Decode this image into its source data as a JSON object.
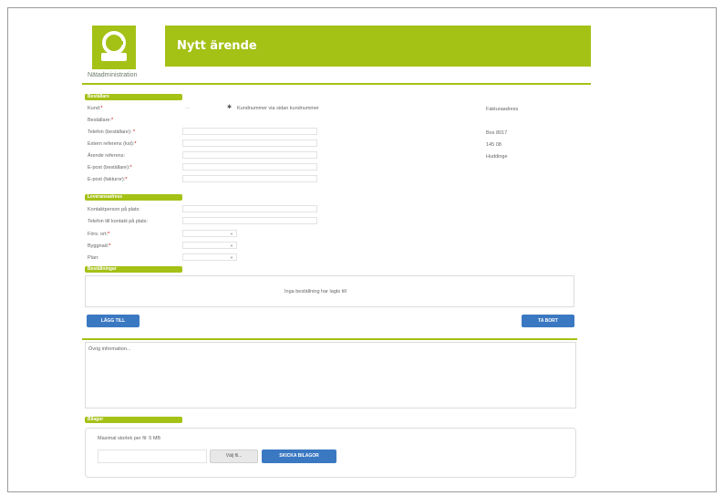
{
  "header": {
    "title": "Nytt ärende",
    "logo_subtitle": "Nätadministration"
  },
  "sections": {
    "bestallare": "Beställare",
    "leveransadress": "Leveransadress",
    "bestallningar": "Beställningar",
    "bilagor": "Bilagor"
  },
  "form": {
    "kund_label": "Kund:",
    "kund_value": "---",
    "kund_help": "Kundnummer via sidan kundnummer",
    "bestallare_label": "Beställare:",
    "telefon_label": "Telefon (beställare):",
    "extern_ref_label": "Extern referens (kst):",
    "arende_ref_label": "Ärende referens:",
    "epost_bestallare_label": "E-post (beställare):",
    "epost_fakturor_label": "E-post (fakturor):",
    "kontaktperson_label": "Kontaktperson på plats:",
    "telefon_kontakt_label": "Telefon till kontakt på plats:",
    "fors_ort_label": "Förs. ort:",
    "byggnad_label": "Byggnad:",
    "plan_label": "Plan:",
    "req_mark": "*"
  },
  "invoice": {
    "heading": "Fakturaadress",
    "line1": "Box 8017",
    "line2": "145 08",
    "line3": "Huddinge"
  },
  "orders": {
    "empty_text": "Inga beställning har lagts till",
    "add_button": "LÄGG TILL",
    "remove_button": "TA BORT"
  },
  "other_info": {
    "placeholder": "Övrig information..."
  },
  "attachments": {
    "max_text": "Maximal storlek per fil: 5 MB",
    "browse_button": "Välj fil...",
    "upload_button": "SKICKA BILAGOR"
  }
}
